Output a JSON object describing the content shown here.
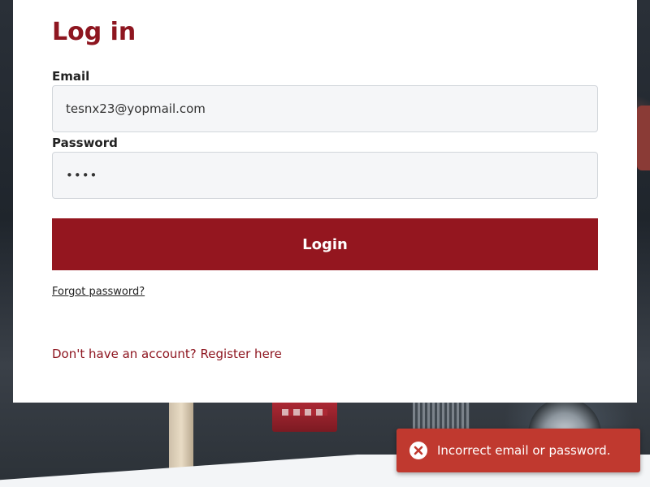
{
  "page": {
    "title": "Log in"
  },
  "form": {
    "email_label": "Email",
    "email_value": "tesnx23@yopmail.com",
    "password_label": "Password",
    "password_value": "••••",
    "login_button": "Login",
    "forgot_link": "Forgot password?",
    "register_link": "Don't have an account? Register here"
  },
  "toast": {
    "message": "Incorrect email or password.",
    "icon": "error-circle-x-icon",
    "color": "#c0392f"
  },
  "colors": {
    "brand": "#8e1620",
    "button": "#94161f"
  }
}
